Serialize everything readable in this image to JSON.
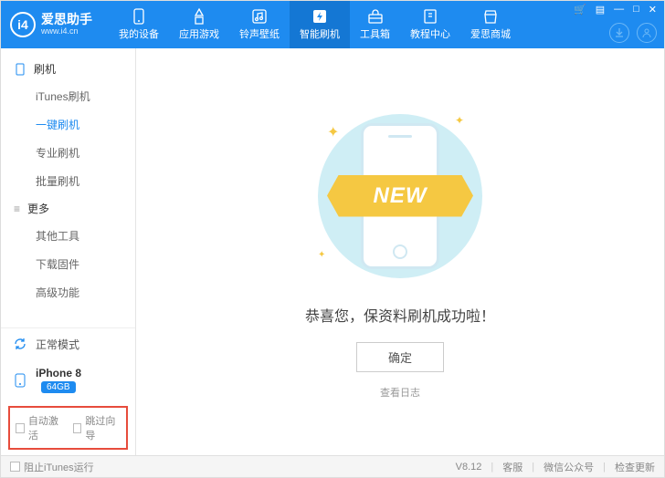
{
  "app": {
    "title": "爱思助手",
    "url": "www.i4.cn",
    "logo_letters": "i4"
  },
  "win": {
    "cart": "🛒",
    "clip": "▤",
    "min": "—",
    "max": "□",
    "close": "✕"
  },
  "nav": [
    {
      "label": "我的设备",
      "icon": "phone"
    },
    {
      "label": "应用游戏",
      "icon": "apps"
    },
    {
      "label": "铃声壁纸",
      "icon": "music"
    },
    {
      "label": "智能刷机",
      "icon": "flash",
      "active": true
    },
    {
      "label": "工具箱",
      "icon": "toolbox"
    },
    {
      "label": "教程中心",
      "icon": "book"
    },
    {
      "label": "爱思商城",
      "icon": "shop"
    }
  ],
  "sidebar": {
    "group1": {
      "title": "刷机",
      "items": [
        "iTunes刷机",
        "一键刷机",
        "专业刷机",
        "批量刷机"
      ],
      "active_index": 1
    },
    "group2": {
      "title": "更多",
      "items": [
        "其他工具",
        "下载固件",
        "高级功能"
      ]
    },
    "status": {
      "mode": "正常模式",
      "device": "iPhone 8",
      "storage": "64GB"
    },
    "checks": {
      "c1": "自动激活",
      "c2": "跳过向导"
    }
  },
  "main": {
    "banner_text": "NEW",
    "message": "恭喜您，保资料刷机成功啦！",
    "ok": "确定",
    "log": "查看日志"
  },
  "footer": {
    "block_itunes": "阻止iTunes运行",
    "version": "V8.12",
    "support": "客服",
    "wechat": "微信公众号",
    "update": "检查更新"
  }
}
